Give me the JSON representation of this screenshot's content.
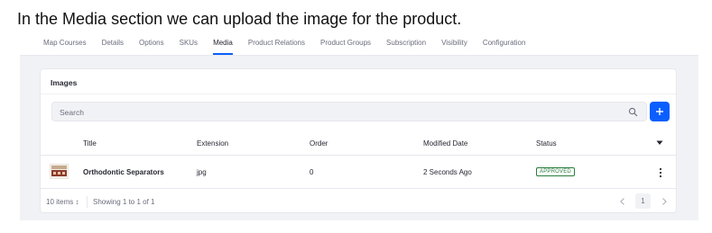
{
  "caption": "In the Media section we can upload the image for the product.",
  "tabs": [
    {
      "label": "Map Courses"
    },
    {
      "label": "Details"
    },
    {
      "label": "Options"
    },
    {
      "label": "SKUs"
    },
    {
      "label": "Media",
      "active": true
    },
    {
      "label": "Product Relations"
    },
    {
      "label": "Product Groups"
    },
    {
      "label": "Subscription"
    },
    {
      "label": "Visibility"
    },
    {
      "label": "Configuration"
    }
  ],
  "images_panel": {
    "title": "Images",
    "search": {
      "placeholder": "Search",
      "icon": "search-icon"
    },
    "add_button": {
      "icon": "plus-icon"
    },
    "columns": [
      "Title",
      "Extension",
      "Order",
      "Modified Date",
      "Status"
    ],
    "sort_icon": "caret-down-icon",
    "rows": [
      {
        "thumbnail": "image-thumbnail",
        "title": "Orthodontic Separators",
        "extension": "jpg",
        "order": "0",
        "modified": "2 Seconds Ago",
        "status": "APPROVED",
        "actions_icon": "kebab-icon"
      }
    ],
    "footer": {
      "items_per_page": "10 items ↕",
      "showing": "Showing 1 to 1 of 1",
      "current_page": "1"
    }
  },
  "colors": {
    "accent": "#0b5fff",
    "approved": "#287d3c",
    "panel_bg": "#f1f2f5"
  }
}
